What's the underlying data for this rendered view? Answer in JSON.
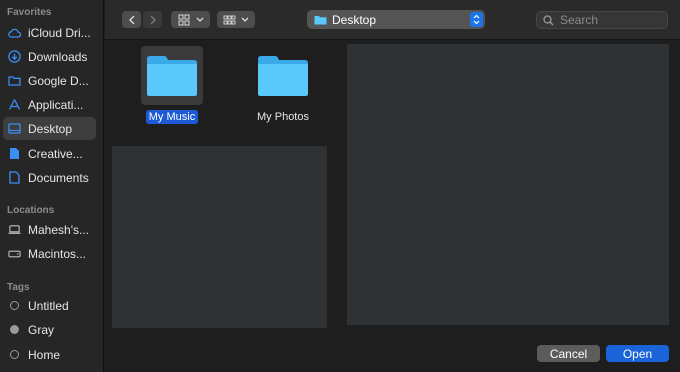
{
  "sidebar": {
    "favorites_heading": "Favorites",
    "favorites": [
      {
        "label": "iCloud Dri...",
        "icon": "cloud-icon"
      },
      {
        "label": "Downloads",
        "icon": "download-icon"
      },
      {
        "label": "Google D...",
        "icon": "folder-icon"
      },
      {
        "label": "Applicati...",
        "icon": "applications-icon"
      },
      {
        "label": "Desktop",
        "icon": "desktop-icon",
        "active": true
      },
      {
        "label": "Creative...",
        "icon": "document-icon"
      },
      {
        "label": "Documents",
        "icon": "document-icon"
      }
    ],
    "locations_heading": "Locations",
    "locations": [
      {
        "label": "Mahesh's...",
        "icon": "laptop-icon"
      },
      {
        "label": "Macintos...",
        "icon": "disk-icon"
      }
    ],
    "tags_heading": "Tags",
    "tags": [
      {
        "label": "Untitled",
        "icon": "tag-dot-icon"
      },
      {
        "label": "Gray",
        "icon": "tag-dot-filled-icon",
        "color": "#9a9a9a"
      },
      {
        "label": "Home",
        "icon": "tag-dot-icon"
      }
    ]
  },
  "toolbar": {
    "current_folder": "Desktop",
    "search_placeholder": "Search"
  },
  "files": [
    {
      "name": "My Music",
      "selected": true
    },
    {
      "name": "My Photos",
      "selected": false
    }
  ],
  "buttons": {
    "cancel": "Cancel",
    "open": "Open"
  },
  "colors": {
    "accent": "#1a63d8",
    "folder": "#5ac8fa",
    "sidebar_icon": "#3b8ef5"
  }
}
